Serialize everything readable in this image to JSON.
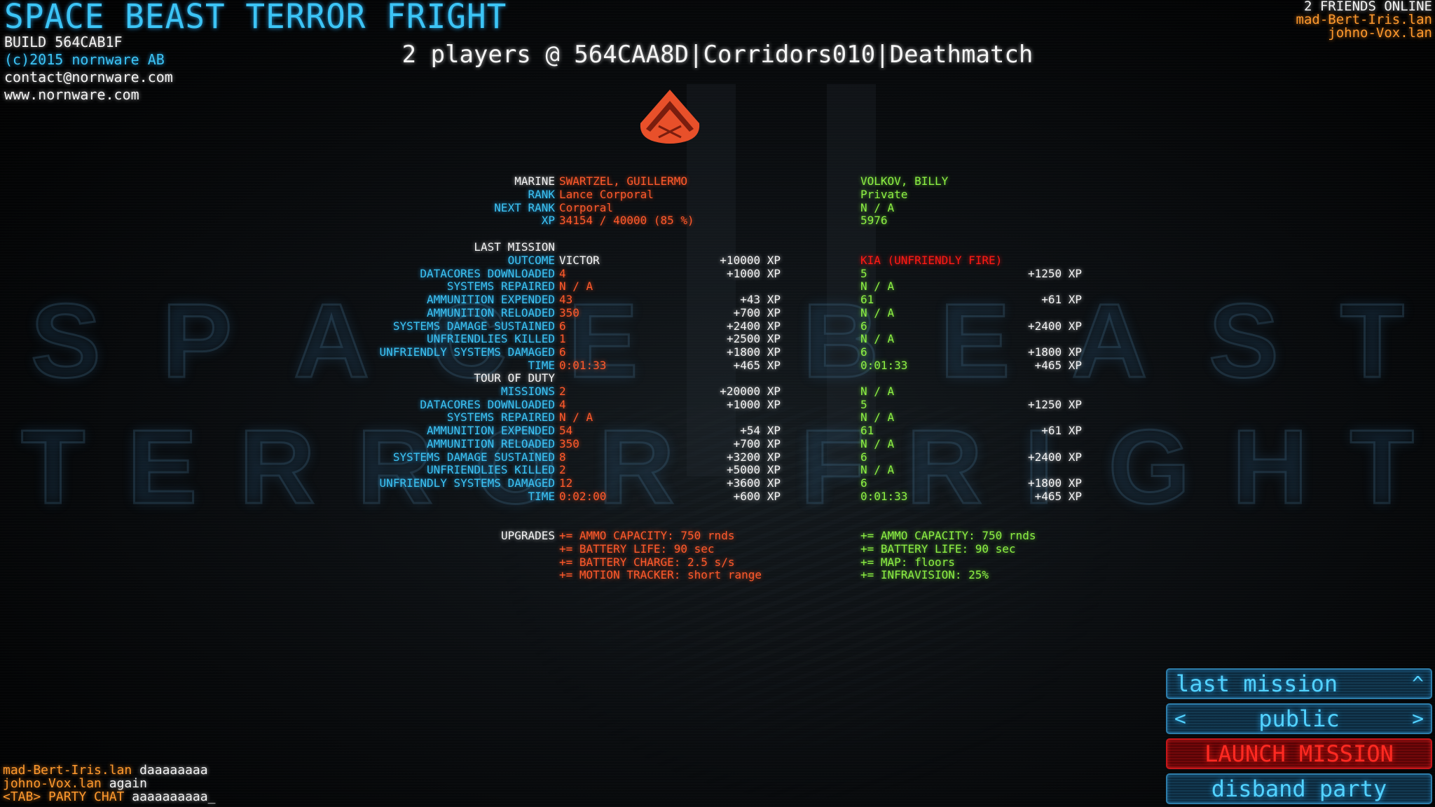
{
  "header": {
    "game_title": "SPACE BEAST TERROR FRIGHT",
    "build": "BUILD 564CAB1F",
    "copyright": "(c)2015 nornware AB",
    "contact": "contact@nornware.com",
    "website": "www.nornware.com",
    "server_line": "2 players @ 564CAA8D|Corridors010|Deathmatch"
  },
  "background_text": {
    "line1": [
      "S",
      "P",
      "A",
      "C",
      "E",
      "",
      "B",
      "E",
      "A",
      "S",
      "T"
    ],
    "line2": [
      "T",
      "E",
      "R",
      "R",
      "O",
      "R",
      "",
      "F",
      "R",
      "I",
      "G",
      "H",
      "T"
    ]
  },
  "friends": {
    "title": "2 FRIENDS ONLINE",
    "list": [
      "mad-Bert-Iris.lan",
      "johno-Vox.lan"
    ]
  },
  "insignia": {
    "icon": "lance-corporal-chevron-icon",
    "color": "#e8502a"
  },
  "profile": {
    "labels": {
      "marine": "MARINE",
      "rank": "RANK",
      "next_rank": "NEXT RANK",
      "xp": "XP"
    },
    "player1": {
      "marine": "SWARTZEL, GUILLERMO",
      "rank": "Lance Corporal",
      "next_rank": "Corporal",
      "xp": "34154 / 40000 (85 %)"
    },
    "player2": {
      "marine": "VOLKOV, BILLY",
      "rank": "Private",
      "next_rank": "N / A",
      "xp": "5976"
    }
  },
  "last_mission": {
    "title": "LAST MISSION",
    "rows": [
      {
        "label": "OUTCOME",
        "p1": "VICTOR",
        "p1_xp": "+10000 XP",
        "p2": "KIA (UNFRIENDLY FIRE)",
        "p2_xp": ""
      },
      {
        "label": "DATACORES DOWNLOADED",
        "p1": "4",
        "p1_xp": "+1000 XP",
        "p2": "5",
        "p2_xp": "+1250 XP"
      },
      {
        "label": "SYSTEMS REPAIRED",
        "p1": "N / A",
        "p1_xp": "",
        "p2": "N / A",
        "p2_xp": ""
      },
      {
        "label": "AMMUNITION EXPENDED",
        "p1": "43",
        "p1_xp": "+43 XP",
        "p2": "61",
        "p2_xp": "+61 XP"
      },
      {
        "label": "AMMUNITION RELOADED",
        "p1": "350",
        "p1_xp": "+700 XP",
        "p2": "N / A",
        "p2_xp": ""
      },
      {
        "label": "SYSTEMS DAMAGE SUSTAINED",
        "p1": "6",
        "p1_xp": "+2400 XP",
        "p2": "6",
        "p2_xp": "+2400 XP"
      },
      {
        "label": "UNFRIENDLIES KILLED",
        "p1": "1",
        "p1_xp": "+2500 XP",
        "p2": "N / A",
        "p2_xp": ""
      },
      {
        "label": "UNFRIENDLY SYSTEMS DAMAGED",
        "p1": "6",
        "p1_xp": "+1800 XP",
        "p2": "6",
        "p2_xp": "+1800 XP"
      },
      {
        "label": "TIME",
        "p1": "0:01:33",
        "p1_xp": "+465 XP",
        "p2": "0:01:33",
        "p2_xp": "+465 XP"
      }
    ]
  },
  "tour_of_duty": {
    "title": "TOUR OF DUTY",
    "rows": [
      {
        "label": "MISSIONS",
        "p1": "2",
        "p1_xp": "+20000 XP",
        "p2": "N / A",
        "p2_xp": ""
      },
      {
        "label": "DATACORES DOWNLOADED",
        "p1": "4",
        "p1_xp": "+1000 XP",
        "p2": "5",
        "p2_xp": "+1250 XP"
      },
      {
        "label": "SYSTEMS REPAIRED",
        "p1": "N / A",
        "p1_xp": "",
        "p2": "N / A",
        "p2_xp": ""
      },
      {
        "label": "AMMUNITION EXPENDED",
        "p1": "54",
        "p1_xp": "+54 XP",
        "p2": "61",
        "p2_xp": "+61 XP"
      },
      {
        "label": "AMMUNITION RELOADED",
        "p1": "350",
        "p1_xp": "+700 XP",
        "p2": "N / A",
        "p2_xp": ""
      },
      {
        "label": "SYSTEMS DAMAGE SUSTAINED",
        "p1": "8",
        "p1_xp": "+3200 XP",
        "p2": "6",
        "p2_xp": "+2400 XP"
      },
      {
        "label": "UNFRIENDLIES KILLED",
        "p1": "2",
        "p1_xp": "+5000 XP",
        "p2": "N / A",
        "p2_xp": ""
      },
      {
        "label": "UNFRIENDLY SYSTEMS DAMAGED",
        "p1": "12",
        "p1_xp": "+3600 XP",
        "p2": "6",
        "p2_xp": "+1800 XP"
      },
      {
        "label": "TIME",
        "p1": "0:02:00",
        "p1_xp": "+600 XP",
        "p2": "0:01:33",
        "p2_xp": "+465 XP"
      }
    ]
  },
  "upgrades": {
    "title": "UPGRADES",
    "p1": [
      "+= AMMO CAPACITY: 750 rnds",
      "+= BATTERY LIFE: 90 sec",
      "+= BATTERY CHARGE: 2.5 s/s",
      "+= MOTION TRACKER: short range"
    ],
    "p2": [
      "+= AMMO CAPACITY: 750 rnds",
      "+= BATTERY LIFE: 90 sec",
      "+= MAP: floors",
      "+= INFRAVISION: 25%"
    ]
  },
  "menu": {
    "last_mission": "last mission",
    "last_mission_arrow": "^",
    "visibility": "public",
    "prev_arrow": "<",
    "next_arrow": ">",
    "launch": "LAUNCH MISSION",
    "disband": "disband party"
  },
  "chat": {
    "messages": [
      {
        "sender": "mad-Bert-Iris.lan",
        "text": "daaaaaaaa"
      },
      {
        "sender": "johno-Vox.lan",
        "text": "again"
      }
    ],
    "prompt": "<TAB> PARTY CHAT",
    "input": "aaaaaaaaaa_"
  },
  "colors": {
    "label_blue": "#3cc4f5",
    "player1_orange": "#ff5a2c",
    "player2_green": "#8ef044",
    "kia_red": "#ff1a14",
    "friends_orange": "#ff9a2e"
  }
}
